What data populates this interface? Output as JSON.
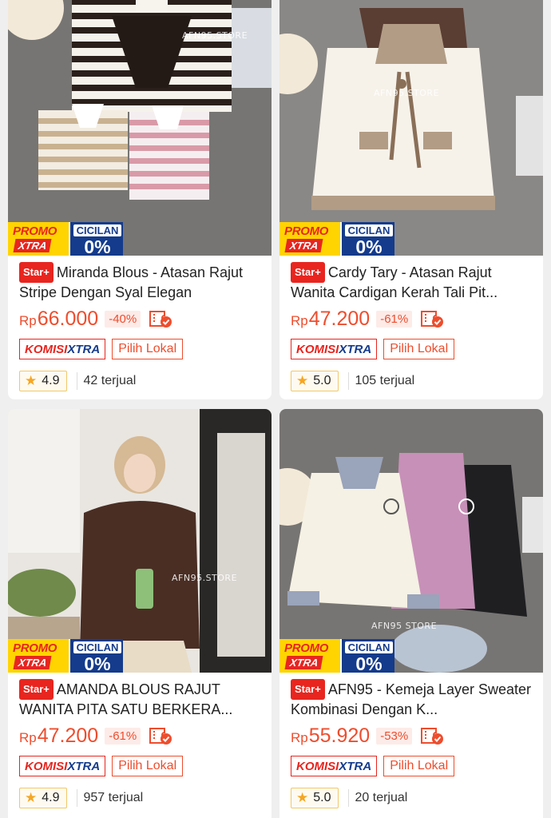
{
  "products": [
    {
      "title": "Miranda Blous - Atasan Rajut Stripe Dengan Syal Elegan",
      "star_badge": "Star+",
      "currency": "Rp",
      "price": "66.000",
      "discount": "-40%",
      "komisi_a": "KOMISI",
      "komisi_b": "XTRA",
      "lokal": "Pilih Lokal",
      "rating": "4.9",
      "sold": "42 terjual",
      "promo_a": "PROMO",
      "promo_b": "XTRA",
      "cicilan_a": "CICILAN",
      "cicilan_b": "0%",
      "watermark": "AFN95.STORE"
    },
    {
      "title": "Cardy Tary - Atasan Rajut Wanita Cardigan Kerah Tali Pit...",
      "star_badge": "Star+",
      "currency": "Rp",
      "price": "47.200",
      "discount": "-61%",
      "komisi_a": "KOMISI",
      "komisi_b": "XTRA",
      "lokal": "Pilih Lokal",
      "rating": "5.0",
      "sold": "105 terjual",
      "promo_a": "PROMO",
      "promo_b": "XTRA",
      "cicilan_a": "CICILAN",
      "cicilan_b": "0%",
      "watermark": "AFN95.STORE"
    },
    {
      "title": "AMANDA BLOUS RAJUT WANITA PITA SATU BERKERA...",
      "star_badge": "Star+",
      "currency": "Rp",
      "price": "47.200",
      "discount": "-61%",
      "komisi_a": "KOMISI",
      "komisi_b": "XTRA",
      "lokal": "Pilih Lokal",
      "rating": "4.9",
      "sold": "957 terjual",
      "promo_a": "PROMO",
      "promo_b": "XTRA",
      "cicilan_a": "CICILAN",
      "cicilan_b": "0%",
      "watermark": "AFN95.STORE"
    },
    {
      "title": "AFN95 - Kemeja Layer Sweater Kombinasi Dengan K...",
      "star_badge": "Star+",
      "currency": "Rp",
      "price": "55.920",
      "discount": "-53%",
      "komisi_a": "KOMISI",
      "komisi_b": "XTRA",
      "lokal": "Pilih Lokal",
      "rating": "5.0",
      "sold": "20 terjual",
      "promo_a": "PROMO",
      "promo_b": "XTRA",
      "cicilan_a": "CICILAN",
      "cicilan_b": "0%",
      "watermark": "AFN95 STORE"
    }
  ],
  "icons": {
    "rating": "star-icon",
    "voucher": "cod-ticket-icon"
  },
  "colors": {
    "accent": "#ee4d2d",
    "promo_yellow": "#ffd400",
    "cicilan_blue": "#143b8c"
  }
}
